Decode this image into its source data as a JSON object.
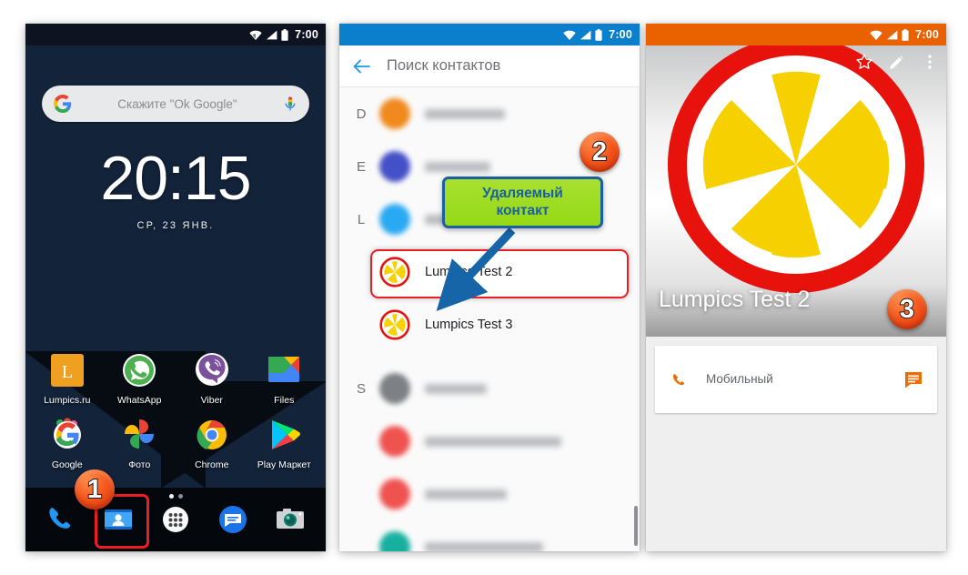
{
  "statusbar": {
    "time": "7:00",
    "icons": [
      "wifi-icon",
      "signal-icon",
      "battery-icon"
    ]
  },
  "phone1": {
    "name": "home-screen",
    "search": {
      "placeholder": "Скажите \"Ok Google\"",
      "logo": "google-g-icon",
      "mic": "microphone-icon"
    },
    "clock": "20:15",
    "date": "СР, 23 ЯНВ.",
    "apps_row1": [
      {
        "label": "Lumpics.ru",
        "icon": "lumpics-icon"
      },
      {
        "label": "WhatsApp",
        "icon": "whatsapp-icon"
      },
      {
        "label": "Viber",
        "icon": "viber-icon"
      },
      {
        "label": "Files",
        "icon": "files-icon"
      }
    ],
    "apps_row2": [
      {
        "label": "Google",
        "icon": "google-icon"
      },
      {
        "label": "Фото",
        "icon": "google-photos-icon"
      },
      {
        "label": "Chrome",
        "icon": "chrome-icon"
      },
      {
        "label": "Play Маркет",
        "icon": "play-store-icon"
      }
    ],
    "dock": [
      {
        "icon": "phone-dialer-icon",
        "label": "Телефон"
      },
      {
        "icon": "contacts-icon",
        "label": "Контакты"
      },
      {
        "icon": "app-drawer-icon",
        "label": "Все приложения"
      },
      {
        "icon": "messages-icon",
        "label": "Сообщения"
      },
      {
        "icon": "camera-icon",
        "label": "Камера"
      }
    ]
  },
  "phone2": {
    "name": "contacts-search-screen",
    "appbar": {
      "back": "back-arrow-icon",
      "title": "Поиск контактов"
    },
    "sections": [
      {
        "letter": "D",
        "contacts": [
          {
            "name": "",
            "blurred": true,
            "avatar_color": "#f08a1e",
            "width": 88
          }
        ]
      },
      {
        "letter": "E",
        "contacts": [
          {
            "name": "",
            "blurred": true,
            "avatar_color": "#4450c7",
            "width": 72
          }
        ]
      },
      {
        "letter": "L",
        "contacts": [
          {
            "name": "",
            "blurred": true,
            "avatar_color": "#29a9f2",
            "width": 96
          },
          {
            "name": "Lumpics Test 2",
            "blurred": false,
            "avatar_color": "lemon",
            "selected": true
          },
          {
            "name": "Lumpics Test 3",
            "blurred": false,
            "avatar_color": "lemon",
            "selected": false
          }
        ]
      },
      {
        "letter": "S",
        "contacts": [
          {
            "name": "",
            "blurred": true,
            "avatar_color": "#7d8084",
            "width": 68
          },
          {
            "name": "",
            "blurred": true,
            "avatar_color": "#ef5350",
            "width": 150
          },
          {
            "name": "",
            "blurred": true,
            "avatar_color": "#ef5350",
            "width": 90
          },
          {
            "name": "",
            "blurred": true,
            "avatar_color": "#17b0a0",
            "width": 130
          }
        ]
      }
    ],
    "callout": {
      "line1": "Удаляемый",
      "line2": "контакт"
    }
  },
  "phone3": {
    "name": "contact-details-screen",
    "actions": [
      {
        "icon": "star-outline-icon",
        "label": "В избранное"
      },
      {
        "icon": "pencil-edit-icon",
        "label": "Изменить"
      },
      {
        "icon": "overflow-menu-icon",
        "label": "Ещё"
      }
    ],
    "contact_name": "Lumpics Test 2",
    "avatar": "lemon-slice-icon",
    "phone_card": {
      "call_icon": "phone-call-icon",
      "number_blurred": true,
      "type_label": "Мобильный",
      "sms_icon": "message-icon"
    }
  },
  "badges": [
    {
      "id": "1",
      "number": "1"
    },
    {
      "id": "2",
      "number": "2"
    },
    {
      "id": "3",
      "number": "3"
    }
  ],
  "colors": {
    "statusbar_blue": "#0b7fcc",
    "statusbar_orange": "#ea6100",
    "highlight_red": "#ee1c25",
    "callout_green": "#95d916",
    "callout_border_blue": "#1a5fa0",
    "badge_orange": "#f4561c",
    "accent_orange": "#ef6c00"
  }
}
